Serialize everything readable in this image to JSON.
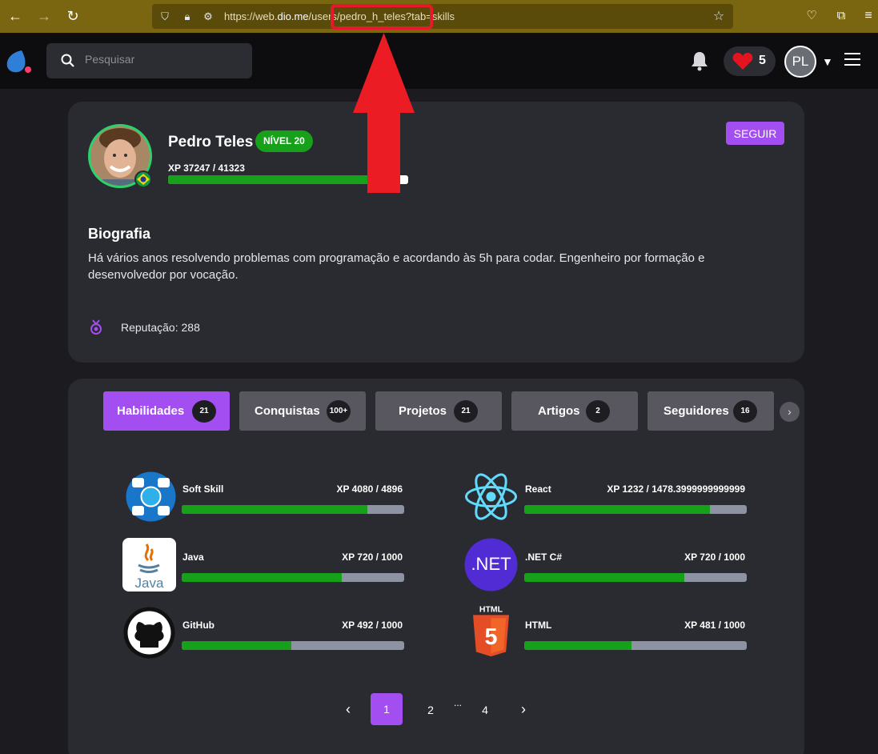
{
  "browser": {
    "url_prefix": "https://web.",
    "url_domain": "dio.me",
    "url_path": "/users/pedro_h_teles?tab=skills"
  },
  "header": {
    "search_placeholder": "Pesquisar",
    "hearts_count": "5",
    "user_initials": "PL"
  },
  "profile": {
    "name": "Pedro Teles",
    "level": "NÍVEL 20",
    "xp_label": "XP 37247 / 41323",
    "xp_fraction": 0.901,
    "follow_label": "SEGUIR",
    "bio_title": "Biografia",
    "bio_text": "Há vários anos resolvendo problemas com programação e acordando às 5h para codar. Engenheiro por formação e desenvolvedor por vocação.",
    "reputation": "Reputação: 288"
  },
  "tabs": [
    {
      "label": "Habilidades",
      "count": "21"
    },
    {
      "label": "Conquistas",
      "count": "100+"
    },
    {
      "label": "Projetos",
      "count": "21"
    },
    {
      "label": "Artigos",
      "count": "2"
    },
    {
      "label": "Seguidores",
      "count": "16"
    }
  ],
  "skills": [
    {
      "name": "Soft Skill",
      "xp": "XP 4080 / 4896",
      "fraction": 0.833
    },
    {
      "name": "React",
      "xp": "XP 1232 / 1478.3999999999999",
      "fraction": 0.833
    },
    {
      "name": "Java",
      "xp": "XP 720 / 1000",
      "fraction": 0.72
    },
    {
      "name": ".NET C#",
      "xp": "XP 720 / 1000",
      "fraction": 0.72
    },
    {
      "name": "GitHub",
      "xp": "XP 492 / 1000",
      "fraction": 0.492
    },
    {
      "name": "HTML",
      "xp": "XP 481 / 1000",
      "fraction": 0.481
    }
  ],
  "icon_labels": {
    "net": ".NET",
    "java": "Java",
    "html": "HTML",
    "html_5": "5"
  },
  "pagination": {
    "prev": "‹",
    "pages": [
      "1",
      "2",
      "4"
    ],
    "ellipsis": "...",
    "next": "›"
  },
  "colors": {
    "accent": "#a24ef0",
    "progress": "#17a11a",
    "highlight": "#e5192a"
  }
}
